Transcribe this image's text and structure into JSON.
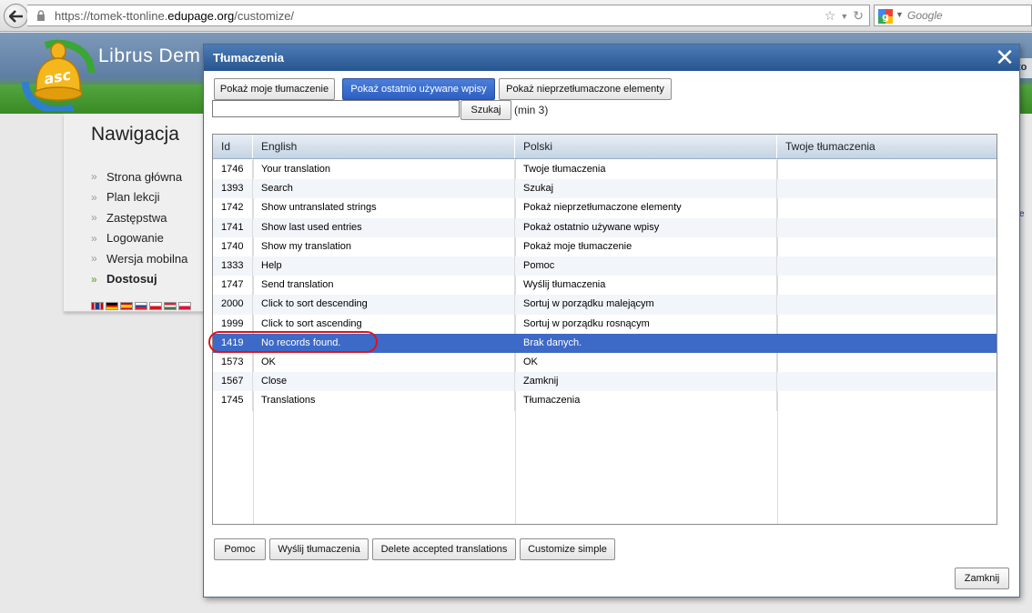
{
  "browser": {
    "url_prefix": "https://tomek-ttonline.",
    "url_domain": "edupage.org",
    "url_suffix": "/customize/",
    "search_placeholder": "Google"
  },
  "site": {
    "title": "Librus Dem",
    "right_fragment": "to",
    "right_fragment2": "e"
  },
  "nav": {
    "title": "Nawigacja",
    "items": [
      {
        "label": "Strona główna",
        "active": false
      },
      {
        "label": "Plan lekcji",
        "active": false
      },
      {
        "label": "Zastępstwa",
        "active": false
      },
      {
        "label": "Logowanie",
        "active": false
      },
      {
        "label": "Wersja mobilna",
        "active": false
      },
      {
        "label": "Dostosuj",
        "active": true
      }
    ],
    "arrow": "»"
  },
  "dialog": {
    "title": "Tłumaczenia",
    "close": "✕",
    "tabs": [
      {
        "label": "Pokaż moje tłumaczenie",
        "selected": false
      },
      {
        "label": "Pokaż ostatnio używane wpisy",
        "selected": true
      },
      {
        "label": "Pokaż nieprzetłumaczone elementy",
        "selected": false
      }
    ],
    "search_button": "Szukaj",
    "search_hint": "(min 3)",
    "columns": [
      "Id",
      "English",
      "Polski",
      "Twoje tłumaczenia"
    ],
    "rows": [
      {
        "id": "1746",
        "en": "Your translation",
        "pl": "Twoje tłumaczenia",
        "yours": ""
      },
      {
        "id": "1393",
        "en": "Search",
        "pl": "Szukaj",
        "yours": ""
      },
      {
        "id": "1742",
        "en": "Show untranslated strings",
        "pl": "Pokaż nieprzetłumaczone elementy",
        "yours": ""
      },
      {
        "id": "1741",
        "en": "Show last used entries",
        "pl": "Pokaż ostatnio używane wpisy",
        "yours": ""
      },
      {
        "id": "1740",
        "en": "Show my translation",
        "pl": "Pokaż moje tłumaczenie",
        "yours": ""
      },
      {
        "id": "1333",
        "en": "Help",
        "pl": "Pomoc",
        "yours": ""
      },
      {
        "id": "1747",
        "en": "Send translation",
        "pl": "Wyślij tłumaczenia",
        "yours": ""
      },
      {
        "id": "2000",
        "en": "Click to sort descending",
        "pl": "Sortuj w porządku malejącym",
        "yours": ""
      },
      {
        "id": "1999",
        "en": "Click to sort ascending",
        "pl": "Sortuj w porządku rosnącym",
        "yours": ""
      },
      {
        "id": "1419",
        "en": "No records found.",
        "pl": "Brak danych.",
        "yours": "",
        "selected": true
      },
      {
        "id": "1573",
        "en": "OK",
        "pl": "OK",
        "yours": ""
      },
      {
        "id": "1567",
        "en": "Close",
        "pl": "Zamknij",
        "yours": ""
      },
      {
        "id": "1745",
        "en": "Translations",
        "pl": "Tłumaczenia",
        "yours": ""
      }
    ],
    "bottom_buttons": [
      "Pomoc",
      "Wyślij tłumaczenia",
      "Delete accepted translations",
      "Customize simple"
    ],
    "close_button": "Zamknij"
  },
  "colors": {
    "dialog_title": "#27558f",
    "selected_row": "#3d69c7",
    "annotation_ring": "#e0131a"
  }
}
